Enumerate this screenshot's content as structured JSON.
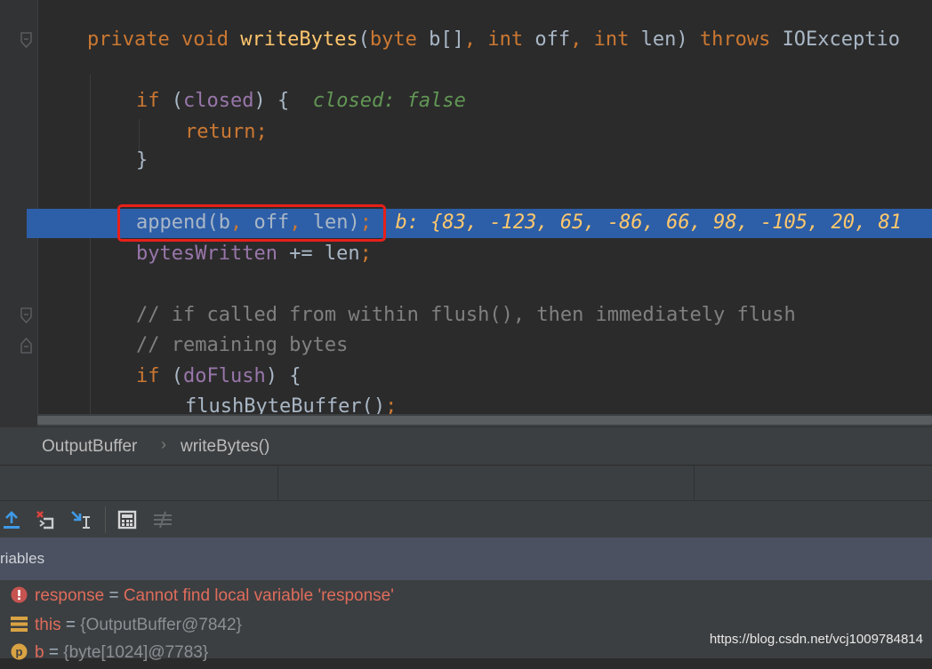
{
  "editor": {
    "lines": [
      {
        "tokens": [
          [
            "kw",
            "private "
          ],
          [
            "kw",
            "void "
          ],
          [
            "fn",
            "writeBytes"
          ],
          [
            "plain",
            "("
          ],
          [
            "kw",
            "byte "
          ],
          [
            "plain",
            "b[]"
          ],
          [
            "kw",
            ", "
          ],
          [
            "kw",
            "int "
          ],
          [
            "plain",
            "off"
          ],
          [
            "kw",
            ", "
          ],
          [
            "kw",
            "int "
          ],
          [
            "plain",
            "len) "
          ],
          [
            "kw",
            "throws "
          ],
          [
            "plain",
            "IOExceptio"
          ]
        ]
      },
      {
        "tokens": [
          [
            "kw",
            "if "
          ],
          [
            "plain",
            "("
          ],
          [
            "field",
            "closed"
          ],
          [
            "plain",
            ") {  "
          ],
          [
            "inline-val",
            "closed: false"
          ]
        ]
      },
      {
        "tokens": [
          [
            "kw",
            "return;"
          ]
        ]
      },
      {
        "tokens": [
          [
            "plain",
            "}"
          ]
        ]
      },
      {
        "tokens": [
          [
            "plain",
            "append(b"
          ],
          [
            "kw",
            ", "
          ],
          [
            "plain",
            "off"
          ],
          [
            "kw",
            ", "
          ],
          [
            "plain",
            "len)"
          ],
          [
            "kw",
            ";"
          ],
          [
            "plain",
            "  "
          ],
          [
            "inline-val-hl",
            "b: {83, -123, 65, -86, 66, 98, -105, 20, 81"
          ]
        ]
      },
      {
        "tokens": [
          [
            "field",
            "bytesWritten "
          ],
          [
            "plain",
            "+= len"
          ],
          [
            "kw",
            ";"
          ]
        ]
      },
      {
        "tokens": [
          [
            "cmt",
            "// if called from within flush(), then immediately flush"
          ]
        ]
      },
      {
        "tokens": [
          [
            "cmt",
            "// remaining bytes"
          ]
        ]
      },
      {
        "tokens": [
          [
            "kw",
            "if "
          ],
          [
            "plain",
            "("
          ],
          [
            "field",
            "doFlush"
          ],
          [
            "plain",
            ") {"
          ]
        ]
      },
      {
        "tokens": [
          [
            "plain",
            "flushByteBuffer()"
          ],
          [
            "kw",
            ";"
          ]
        ]
      }
    ]
  },
  "breadcrumb": {
    "items": [
      "OutputBuffer",
      "writeBytes()"
    ],
    "separator": "›"
  },
  "debug": {
    "toolbar_icons": [
      "step-out-icon",
      "drop-frame-icon",
      "run-to-cursor-icon",
      "evaluate-expression-icon",
      "trace-icon"
    ],
    "variables_title": "riables",
    "variables": [
      {
        "icon": "error-icon",
        "name": "response",
        "eq": " = ",
        "value": "Cannot find local variable 'response'",
        "kind": "error"
      },
      {
        "icon": "object-icon",
        "name": "this",
        "eq": " = ",
        "value": "{OutputBuffer@7842}",
        "kind": "value"
      },
      {
        "icon": "param-icon",
        "name": "b",
        "eq": " = ",
        "value": "{byte[1024]@7783}",
        "kind": "value"
      }
    ]
  },
  "watermark": "https://blog.csdn.net/vcj1009784814",
  "colors": {
    "background": "#2b2b2b",
    "keyword": "#cc7832",
    "function": "#ffc66d",
    "field": "#9876aa",
    "comment": "#808080",
    "execution_line": "#2d5ea8",
    "highlight_box": "#e8201a"
  }
}
